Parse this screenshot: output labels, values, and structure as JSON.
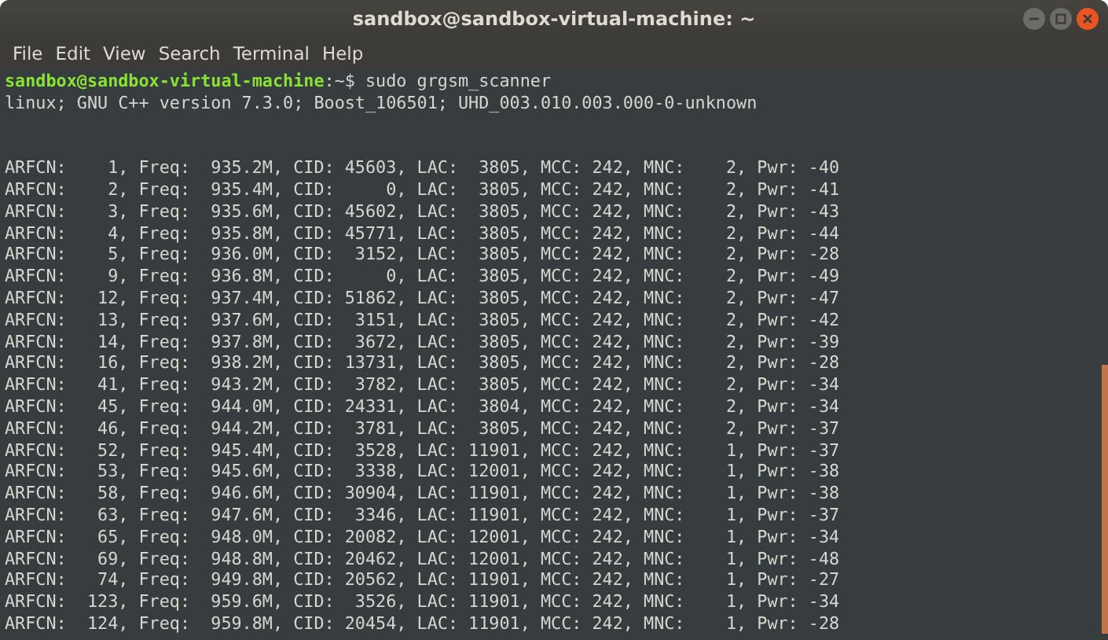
{
  "window": {
    "title": "sandbox@sandbox-virtual-machine: ~"
  },
  "menu": [
    "File",
    "Edit",
    "View",
    "Search",
    "Terminal",
    "Help"
  ],
  "prompt": {
    "user_host": "sandbox@sandbox-virtual-machine",
    "path": ":~$",
    "command": " sudo grgsm_scanner"
  },
  "output": [
    "linux; GNU C++ version 7.3.0; Boost_106501; UHD_003.010.003.000-0-unknown"
  ],
  "scan_rows": [
    "ARFCN:    1, Freq:  935.2M, CID: 45603, LAC:  3805, MCC: 242, MNC:    2, Pwr: -40",
    "ARFCN:    2, Freq:  935.4M, CID:     0, LAC:  3805, MCC: 242, MNC:    2, Pwr: -41",
    "ARFCN:    3, Freq:  935.6M, CID: 45602, LAC:  3805, MCC: 242, MNC:    2, Pwr: -43",
    "ARFCN:    4, Freq:  935.8M, CID: 45771, LAC:  3805, MCC: 242, MNC:    2, Pwr: -44",
    "ARFCN:    5, Freq:  936.0M, CID:  3152, LAC:  3805, MCC: 242, MNC:    2, Pwr: -28",
    "ARFCN:    9, Freq:  936.8M, CID:     0, LAC:  3805, MCC: 242, MNC:    2, Pwr: -49",
    "ARFCN:   12, Freq:  937.4M, CID: 51862, LAC:  3805, MCC: 242, MNC:    2, Pwr: -47",
    "ARFCN:   13, Freq:  937.6M, CID:  3151, LAC:  3805, MCC: 242, MNC:    2, Pwr: -42",
    "ARFCN:   14, Freq:  937.8M, CID:  3672, LAC:  3805, MCC: 242, MNC:    2, Pwr: -39",
    "ARFCN:   16, Freq:  938.2M, CID: 13731, LAC:  3805, MCC: 242, MNC:    2, Pwr: -28",
    "ARFCN:   41, Freq:  943.2M, CID:  3782, LAC:  3805, MCC: 242, MNC:    2, Pwr: -34",
    "ARFCN:   45, Freq:  944.0M, CID: 24331, LAC:  3804, MCC: 242, MNC:    2, Pwr: -34",
    "ARFCN:   46, Freq:  944.2M, CID:  3781, LAC:  3805, MCC: 242, MNC:    2, Pwr: -37",
    "ARFCN:   52, Freq:  945.4M, CID:  3528, LAC: 11901, MCC: 242, MNC:    1, Pwr: -37",
    "ARFCN:   53, Freq:  945.6M, CID:  3338, LAC: 12001, MCC: 242, MNC:    1, Pwr: -38",
    "ARFCN:   58, Freq:  946.6M, CID: 30904, LAC: 11901, MCC: 242, MNC:    1, Pwr: -38",
    "ARFCN:   63, Freq:  947.6M, CID:  3346, LAC: 11901, MCC: 242, MNC:    1, Pwr: -37",
    "ARFCN:   65, Freq:  948.0M, CID: 20082, LAC: 12001, MCC: 242, MNC:    1, Pwr: -34",
    "ARFCN:   69, Freq:  948.8M, CID: 20462, LAC: 12001, MCC: 242, MNC:    1, Pwr: -48",
    "ARFCN:   74, Freq:  949.8M, CID: 20562, LAC: 11901, MCC: 242, MNC:    1, Pwr: -27",
    "ARFCN:  123, Freq:  959.6M, CID:  3526, LAC: 11901, MCC: 242, MNC:    1, Pwr: -34",
    "ARFCN:  124, Freq:  959.8M, CID: 20454, LAC: 11901, MCC: 242, MNC:    1, Pwr: -28"
  ]
}
